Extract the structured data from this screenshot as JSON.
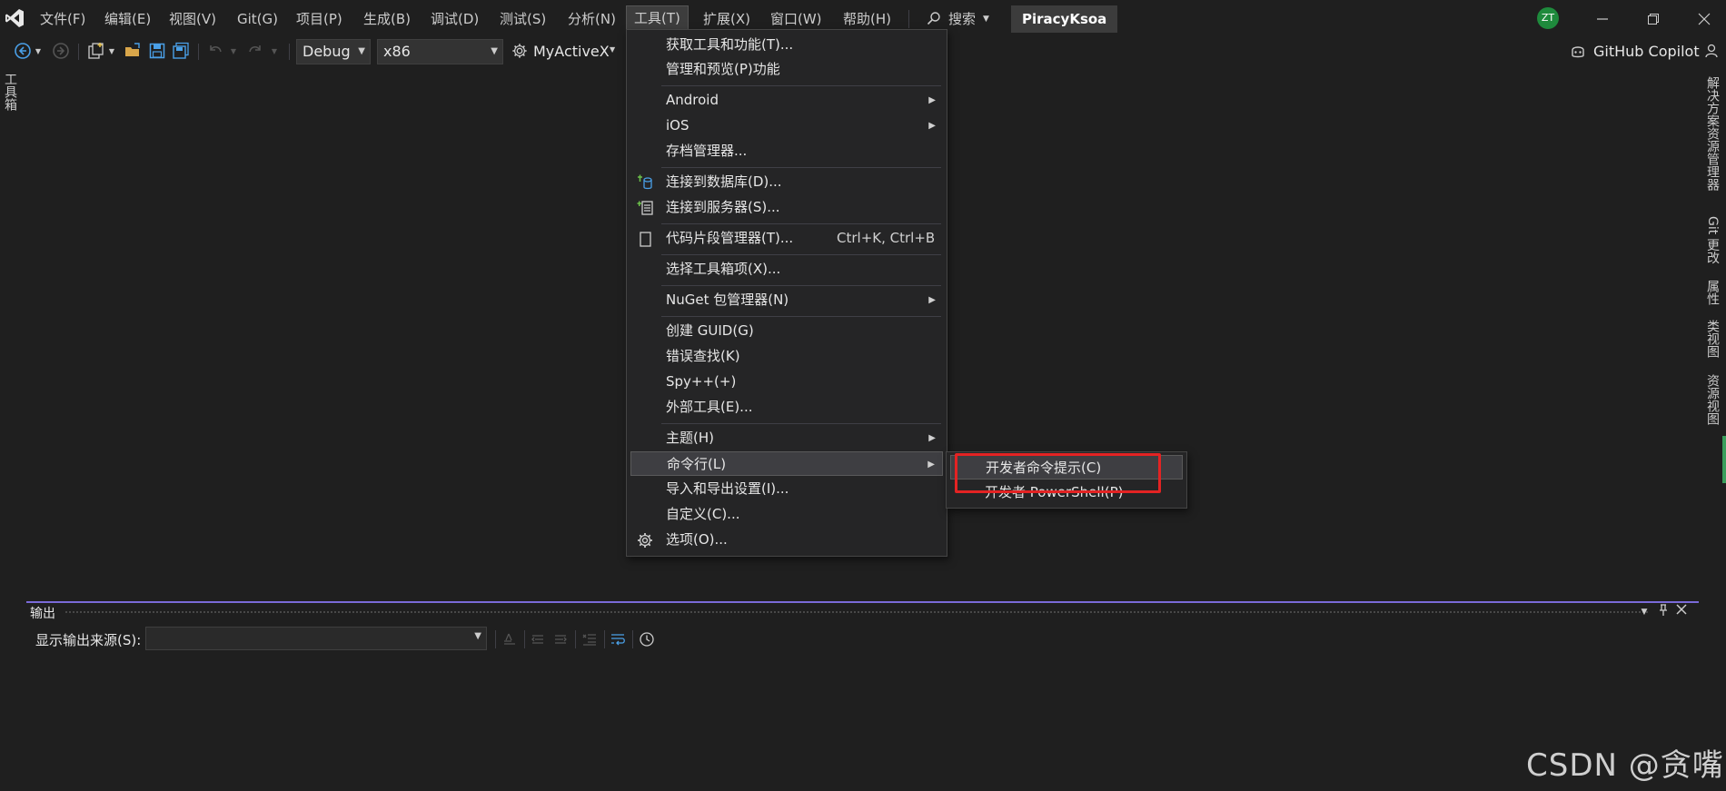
{
  "menubar": {
    "items": [
      "文件(F)",
      "编辑(E)",
      "视图(V)",
      "Git(G)",
      "项目(P)",
      "生成(B)",
      "调试(D)",
      "测试(S)",
      "分析(N)",
      "工具(T)",
      "扩展(X)",
      "窗口(W)",
      "帮助(H)"
    ],
    "search_label": "搜索",
    "project_name": "PiracyKsoa",
    "avatar_initials": "ZT"
  },
  "toolbar": {
    "config": "Debug",
    "platform": "x86",
    "startup_project": "MyActiveX",
    "copilot_label": "GitHub Copilot"
  },
  "left_strip": {
    "toolbox": "工具箱"
  },
  "right_strip": {
    "solution_explorer": "解决方案资源管理器",
    "git_changes": "Git 更改",
    "properties": "属性",
    "class_view": "类视图",
    "resource_view": "资源视图"
  },
  "tools_menu": {
    "items": [
      {
        "label": "获取工具和功能(T)..."
      },
      {
        "label": "管理和预览(P)功能"
      },
      {
        "label": "Android"
      },
      {
        "label": "iOS"
      },
      {
        "label": "存档管理器..."
      },
      {
        "label": "连接到数据库(D)..."
      },
      {
        "label": "连接到服务器(S)..."
      },
      {
        "label": "代码片段管理器(T)...",
        "shortcut": "Ctrl+K, Ctrl+B"
      },
      {
        "label": "选择工具箱项(X)..."
      },
      {
        "label": "NuGet 包管理器(N)"
      },
      {
        "label": "创建 GUID(G)"
      },
      {
        "label": "错误查找(K)"
      },
      {
        "label": "Spy++(+)"
      },
      {
        "label": "外部工具(E)..."
      },
      {
        "label": "主题(H)"
      },
      {
        "label": "命令行(L)"
      },
      {
        "label": "导入和导出设置(I)..."
      },
      {
        "label": "自定义(C)..."
      },
      {
        "label": "选项(O)..."
      }
    ]
  },
  "command_line_submenu": {
    "items": [
      {
        "label": "开发者命令提示(C)"
      },
      {
        "label": "开发者 PowerShell(P)"
      }
    ]
  },
  "output_panel": {
    "title": "输出",
    "source_label": "显示输出来源(S):",
    "source_value": ""
  },
  "watermark": "CSDN @贪嘴",
  "colors": {
    "highlight_border": "#e32323",
    "panel_accent": "#7a6ad8",
    "avatar": "#1e8a3c"
  }
}
